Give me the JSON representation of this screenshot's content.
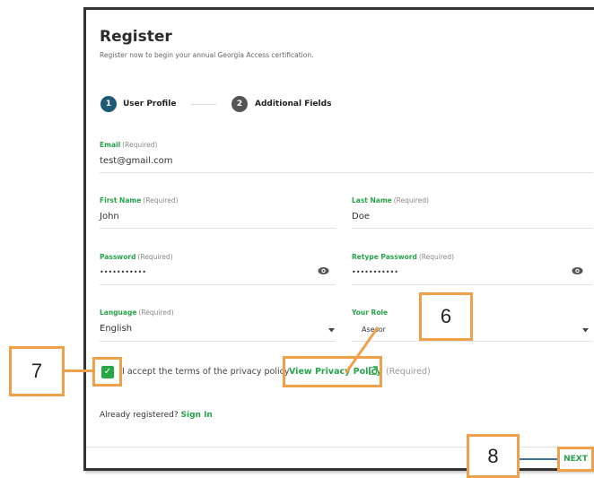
{
  "form": {
    "title": "Register",
    "subtitle": "Register now to begin your annual Georgia Access certification.",
    "steps": [
      {
        "number": "1",
        "label": "User Profile"
      },
      {
        "number": "2",
        "label": "Additional Fields"
      }
    ],
    "required_tag": "(Required)",
    "email": {
      "label": "Email",
      "value": "test@gmail.com"
    },
    "first_name": {
      "label": "First Name",
      "value": "John"
    },
    "last_name": {
      "label": "Last Name",
      "value": "Doe"
    },
    "password": {
      "label": "Password",
      "value": "•••••••••••"
    },
    "retype_password": {
      "label": "Retype Password",
      "value": "•••••••••••"
    },
    "language": {
      "label": "Language",
      "value": "English"
    },
    "role": {
      "label": "Your Role",
      "value": "Asesor"
    },
    "terms": {
      "text": "I accept the terms of the privacy policy",
      "link": "View Privacy Policy",
      "required": "(Required)",
      "checked": true
    },
    "already_registered": "Already registered?",
    "sign_in": "Sign In",
    "next_label": "NEXT"
  },
  "callouts": {
    "c6": "6",
    "c7": "7",
    "c8": "8"
  },
  "colors": {
    "accent_green": "#27a44a",
    "step_active": "#1d5a78",
    "callout_orange": "#f0a04b",
    "connector_blue": "#3a6fa3"
  },
  "icons": {
    "checkbox": "check-icon",
    "password_toggle": "eye-icon",
    "dropdown": "caret-down-icon",
    "external_link": "external-link-icon"
  }
}
